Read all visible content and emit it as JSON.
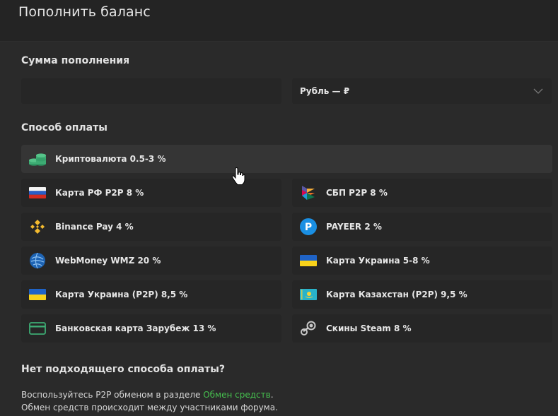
{
  "header": {
    "title": "Пополнить баланс"
  },
  "amount": {
    "title": "Сумма пополнения",
    "value": "",
    "currency": "Рубль — ₽"
  },
  "payment": {
    "title": "Способ оплаты",
    "methods": [
      {
        "label": "Криптовалюта 0.5-3 %",
        "icon": "coins-icon"
      },
      {
        "label": "Карта РФ P2P 8 %",
        "icon": "russia-flag-icon"
      },
      {
        "label": "СБП P2P 8 %",
        "icon": "sbp-icon"
      },
      {
        "label": "Binance Pay 4 %",
        "icon": "binance-icon"
      },
      {
        "label": "PAYEER 2 %",
        "icon": "payeer-icon"
      },
      {
        "label": "WebMoney WMZ 20 %",
        "icon": "webmoney-icon"
      },
      {
        "label": "Карта Украина 5-8 %",
        "icon": "ukraine-flag-icon"
      },
      {
        "label": "Карта Украина (P2P) 8,5 %",
        "icon": "ukraine-flag-icon"
      },
      {
        "label": "Карта Казахстан (P2P) 9,5 %",
        "icon": "kazakhstan-flag-icon"
      },
      {
        "label": "Банковская карта Зарубеж 13 %",
        "icon": "bank-card-icon"
      },
      {
        "label": "Скины Steam 8 %",
        "icon": "steam-icon"
      }
    ]
  },
  "note": {
    "title": "Нет подходящего способа оплаты?",
    "line1_prefix": "Воспользуйтесь P2P обменом в разделе ",
    "line1_link": "Обмен средств",
    "line1_suffix": ".",
    "line2": "Обмен средств происходит между участниками форума."
  },
  "colors": {
    "accent_link": "#46c04f",
    "coin_green": "#3dab73"
  }
}
